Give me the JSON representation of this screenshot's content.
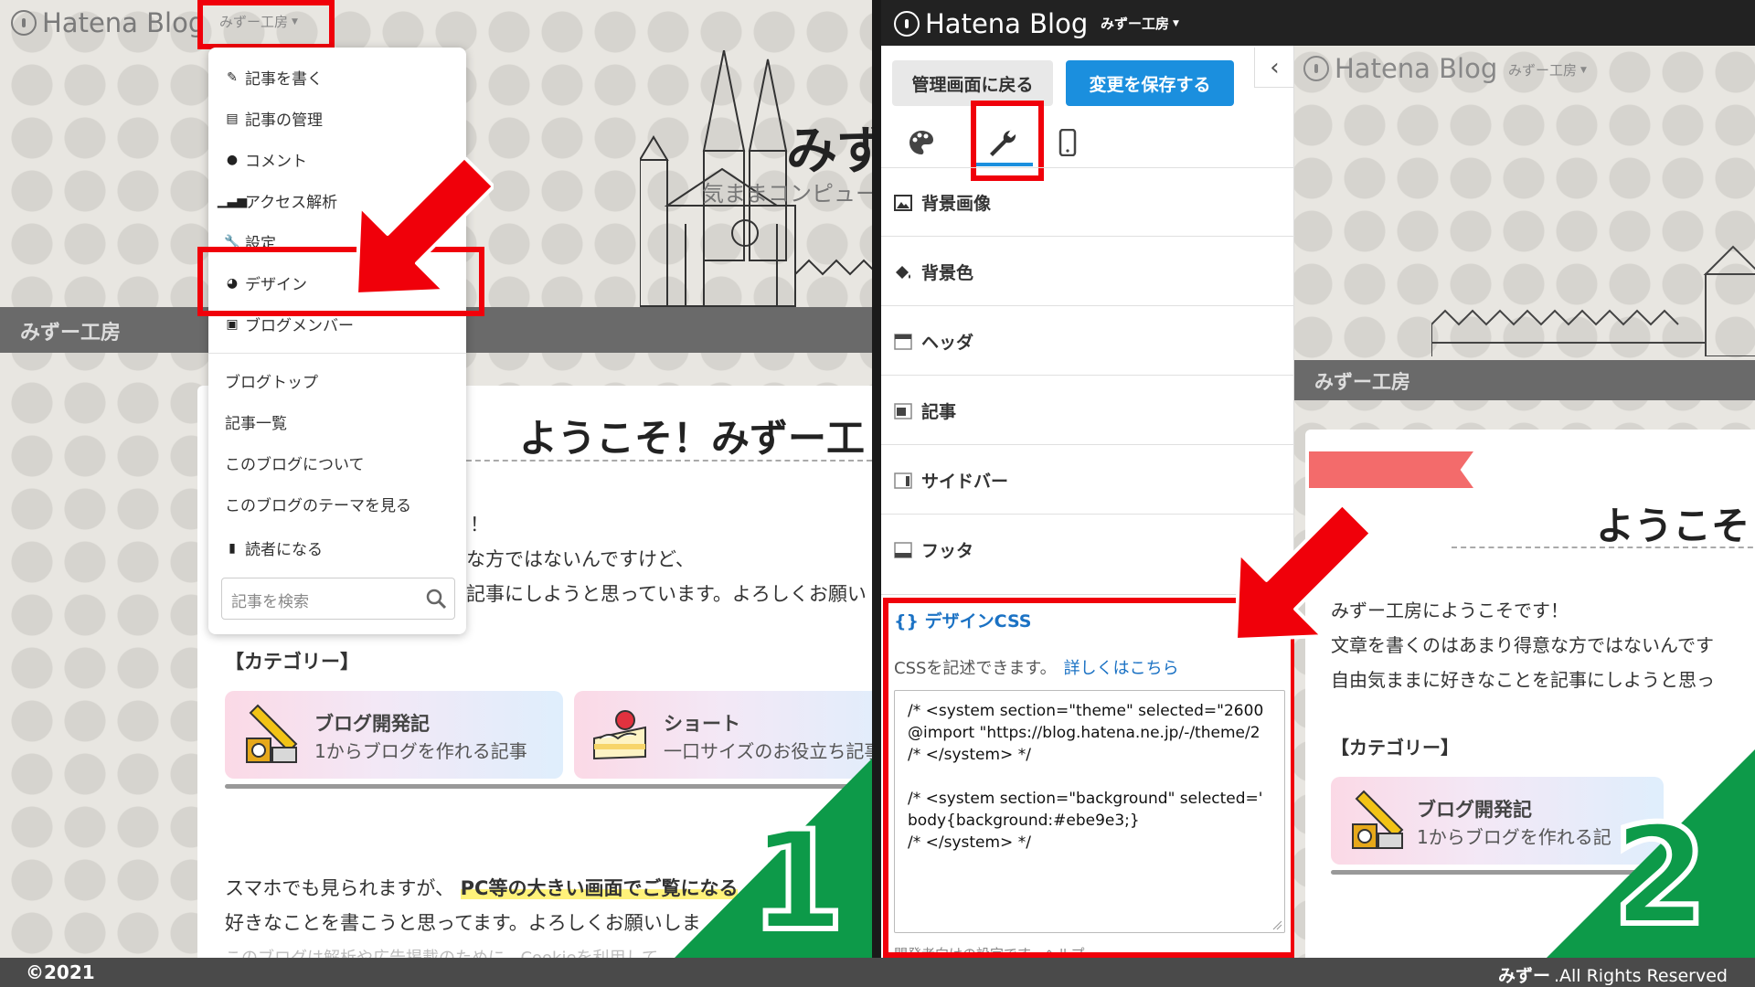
{
  "hatena_logo": "Hatena Blog",
  "blog_dropdown": "みずー工房",
  "panel1": {
    "blog_title": "みず",
    "blog_subtitle": "気ままコンピュー",
    "band_label": "みずー工房",
    "menu": {
      "items": [
        {
          "label": "記事を書く",
          "icon": "edit-icon"
        },
        {
          "label": "記事の管理",
          "icon": "document-icon"
        },
        {
          "label": "コメント",
          "icon": "comment-icon"
        },
        {
          "label": "アクセス解析",
          "icon": "bar-chart-icon"
        },
        {
          "label": "設定",
          "icon": "wrench-icon"
        },
        {
          "label": "デザイン",
          "icon": "palette-icon"
        },
        {
          "label": "ブログメンバー",
          "icon": "members-icon"
        }
      ],
      "links": [
        "ブログトップ",
        "記事一覧",
        "このブログについて",
        "このブログのテーマを見る"
      ],
      "reader": {
        "label": "読者になる",
        "icon": "bookmark-icon"
      },
      "search_placeholder": "記事を検索"
    },
    "heading": "ようこそ！みずー工",
    "intro_lines": [
      "！",
      "な方ではないんですけど、",
      "記事にしようと思っています。よろしくお願い"
    ],
    "category_label": "【カテゴリー】",
    "cards": [
      {
        "title": "ブログ開発記",
        "desc": "1からブログを作れる記事",
        "icon": "crane-icon"
      },
      {
        "title": "ショート",
        "desc": "一口サイズのお役立ち記事",
        "icon": "cake-icon"
      }
    ],
    "bottom_line1_plain": "スマホでも見られますが、",
    "bottom_line1_marked": "PC等の大きい画面でご覧になる",
    "bottom_line2": "好きなことを書こうと思ってます。よろしくお願いしま",
    "faint_line": "このブログは解析や広告掲載のために、Cookieを利用して",
    "step_number": "1"
  },
  "panel2": {
    "buttons": {
      "back": "管理画面に戻る",
      "save": "変更を保存する"
    },
    "tabs": [
      {
        "name": "tab-theme",
        "icon": "palette-icon"
      },
      {
        "name": "tab-customize",
        "icon": "wrench-icon"
      },
      {
        "name": "tab-smartphone",
        "icon": "smartphone-icon"
      }
    ],
    "sections": [
      "背景画像",
      "背景色",
      "ヘッダ",
      "記事",
      "サイドバー",
      "フッタ"
    ],
    "design_css": {
      "title": "{} デザインCSS",
      "desc": "CSSを記述できます。",
      "link": "詳しくはこちら",
      "code_lines": [
        "/* <system section=\"theme\" selected=\"2600",
        "@import \"https://blog.hatena.ne.jp/-/theme/2",
        "/* </system> */",
        "",
        "/* <system section=\"background\" selected='",
        "body{background:#ebe9e3;}",
        "/* </system> */"
      ],
      "bottom_note": "開発者向けの設定です。ヘルプ"
    },
    "preview": {
      "band_label": "みずー工房",
      "heading": "ようこそ",
      "lines": [
        "みずー工房にようこそです！",
        "文章を書くのはあまり得意な方ではないんです",
        "自由気ままに好きなことを記事にしようと思っ"
      ],
      "category_label": "【カテゴリー】",
      "card_title": "ブログ開発記",
      "card_desc": "1からブログを作れる記"
    },
    "step_number": "2"
  },
  "footer": {
    "copyright": "©2021",
    "right_bold": "みずー",
    "right_text": ".All Rights Reserved"
  },
  "colors": {
    "highlight_red": "#f0000a",
    "step_green": "#0d9a49",
    "save_blue": "#1b8fde",
    "link_blue": "#1b72c4",
    "ribbon": "#f36b6b"
  }
}
